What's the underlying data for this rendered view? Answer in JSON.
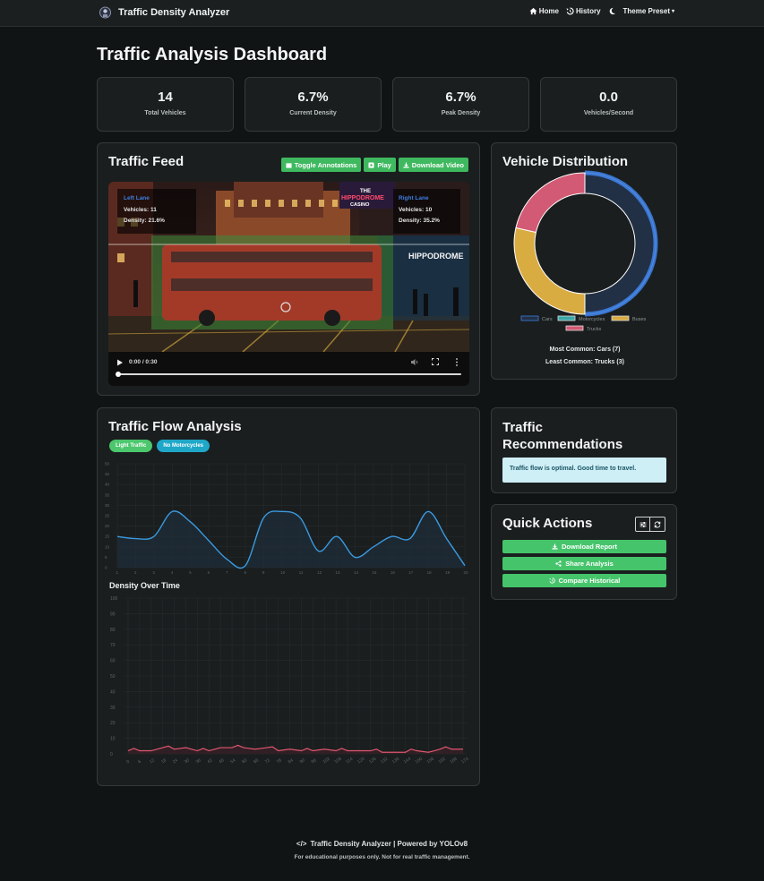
{
  "nav": {
    "brand": "Traffic Density Analyzer",
    "home": "Home",
    "history": "History",
    "theme": "Theme Preset"
  },
  "page_title": "Traffic Analysis Dashboard",
  "stats": [
    {
      "value": "14",
      "label": "Total Vehicles"
    },
    {
      "value": "6.7%",
      "label": "Current Density"
    },
    {
      "value": "6.7%",
      "label": "Peak Density"
    },
    {
      "value": "0.0",
      "label": "Vehicles/Second"
    }
  ],
  "feed": {
    "title": "Traffic Feed",
    "toggle_label": "Toggle Annotations",
    "play_label": "Play",
    "download_label": "Download Video",
    "left_lane": {
      "name": "Left Lane",
      "vehicles": "Vehicles: 11",
      "density": "Density: 21.6%"
    },
    "right_lane": {
      "name": "Right Lane",
      "vehicles": "Vehicles: 10",
      "density": "Density: 35.2%"
    },
    "sign1": "THE",
    "sign2": "HIPPODROME",
    "sign3": "CASINO",
    "sign4": "HIPPODROME",
    "time": "0:00 / 0:30",
    "progress": 0.0
  },
  "distribution": {
    "title": "Vehicle Distribution",
    "most_common": "Most Common: Cars (7)",
    "least_common": "Least Common: Trucks (3)"
  },
  "flow": {
    "title": "Traffic Flow Analysis",
    "badge1": "Light Traffic",
    "badge2": "No Motorcycles",
    "density_title": "Density Over Time"
  },
  "recommendations": {
    "title_line1": "Traffic",
    "title_line2": "Recommendations",
    "message": "Traffic flow is optimal. Good time to travel."
  },
  "quick_actions": {
    "title": "Quick Actions",
    "download": "Download Report",
    "share": "Share Analysis",
    "compare": "Compare Historical"
  },
  "footer": {
    "line1": "Traffic Density Analyzer | Powered by YOLOv8",
    "line2": "For educational purposes only. Not for real traffic management."
  },
  "colors": {
    "accent_green": "#3fb95f",
    "cars": "#3d7ee0",
    "motorcycles": "#3aa7a7",
    "buses": "#d9ac42",
    "trucks": "#d35a74",
    "flow_line": "#3a9ae0",
    "density_line": "#e0566f"
  },
  "chart_data": [
    {
      "type": "pie",
      "categories": [
        "Cars",
        "Motorcycles",
        "Buses",
        "Trucks"
      ],
      "values": [
        7,
        0,
        4,
        3
      ],
      "legend": "bottom"
    },
    {
      "type": "line",
      "x": [
        1,
        2,
        3,
        4,
        5,
        6,
        7,
        8,
        9,
        10,
        11,
        12,
        13,
        14,
        15,
        16,
        17,
        18,
        19,
        20
      ],
      "values": [
        15,
        14,
        15,
        27,
        22,
        13,
        4,
        1,
        24,
        27,
        24,
        8,
        15,
        5,
        10,
        15,
        14,
        27,
        14,
        1
      ],
      "ylim": [
        0,
        50
      ],
      "yticks": [
        "0",
        "5",
        "10",
        "15",
        "20",
        "25",
        "30",
        "35",
        "40",
        "45",
        "50"
      ],
      "grid": true
    },
    {
      "type": "area",
      "title": "Density Over Time",
      "x": [
        "0",
        "6",
        "12",
        "18",
        "24",
        "30",
        "36",
        "42",
        "48",
        "54",
        "60",
        "66",
        "72",
        "78",
        "84",
        "90",
        "96",
        "102",
        "108",
        "114",
        "120",
        "126",
        "132",
        "138",
        "144",
        "150",
        "156",
        "162",
        "168",
        "174"
      ],
      "values": [
        2,
        2,
        2,
        4,
        3,
        4,
        2,
        2,
        4,
        4,
        4,
        3,
        4,
        2,
        3,
        2,
        2,
        3,
        2,
        2,
        2,
        2,
        1,
        1,
        1,
        2,
        1,
        3,
        3,
        3
      ],
      "ylim": [
        0,
        100
      ],
      "yticks": [
        "0",
        "10",
        "20",
        "30",
        "40",
        "50",
        "60",
        "70",
        "80",
        "90",
        "100"
      ],
      "grid": true
    }
  ]
}
